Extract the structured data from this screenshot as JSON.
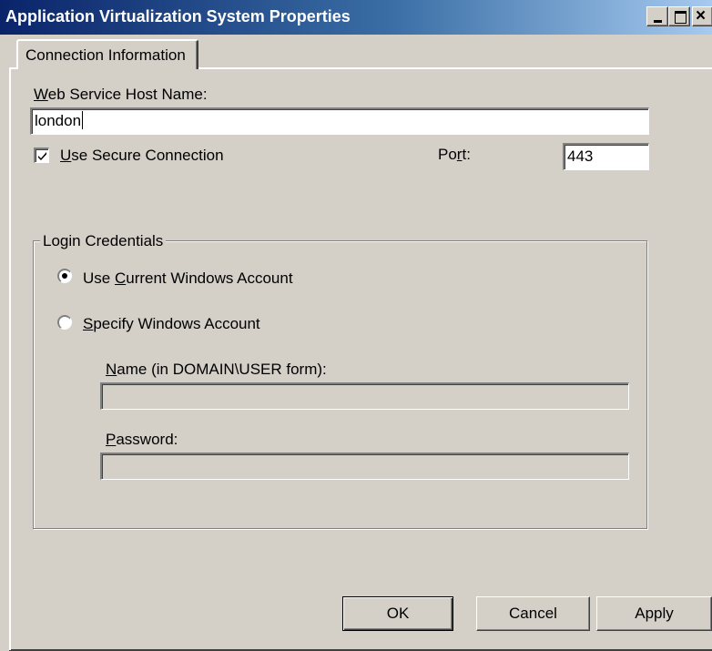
{
  "window": {
    "title": "Application Virtualization System Properties",
    "controls": {
      "minimize": "_",
      "maximize": "□",
      "close": "×"
    }
  },
  "tabs": [
    {
      "label": "Connection Information",
      "selected": true
    }
  ],
  "connection": {
    "host_label_prefix": "",
    "host_label_mnemonic": "W",
    "host_label_rest": "eb Service Host Name:",
    "host_value": "london",
    "secure_checked": true,
    "secure_label_mnemonic": "U",
    "secure_label_rest": "se Secure Connection",
    "port_label_prefix": "Po",
    "port_label_mnemonic": "r",
    "port_label_rest": "t:",
    "port_value": "443"
  },
  "credentials": {
    "group_label": "Login Credentials",
    "option_current_prefix": "Use ",
    "option_current_mnemonic": "C",
    "option_current_rest": "urrent Windows Account",
    "option_current_selected": true,
    "option_specify_mnemonic": "S",
    "option_specify_rest": "pecify Windows Account",
    "option_specify_selected": false,
    "name_label_mnemonic": "N",
    "name_label_rest": "ame (in DOMAIN\\USER form):",
    "name_value": "",
    "password_label_mnemonic": "P",
    "password_label_rest": "assword:",
    "password_value": ""
  },
  "buttons": {
    "ok": "OK",
    "cancel": "Cancel",
    "apply": "Apply"
  }
}
